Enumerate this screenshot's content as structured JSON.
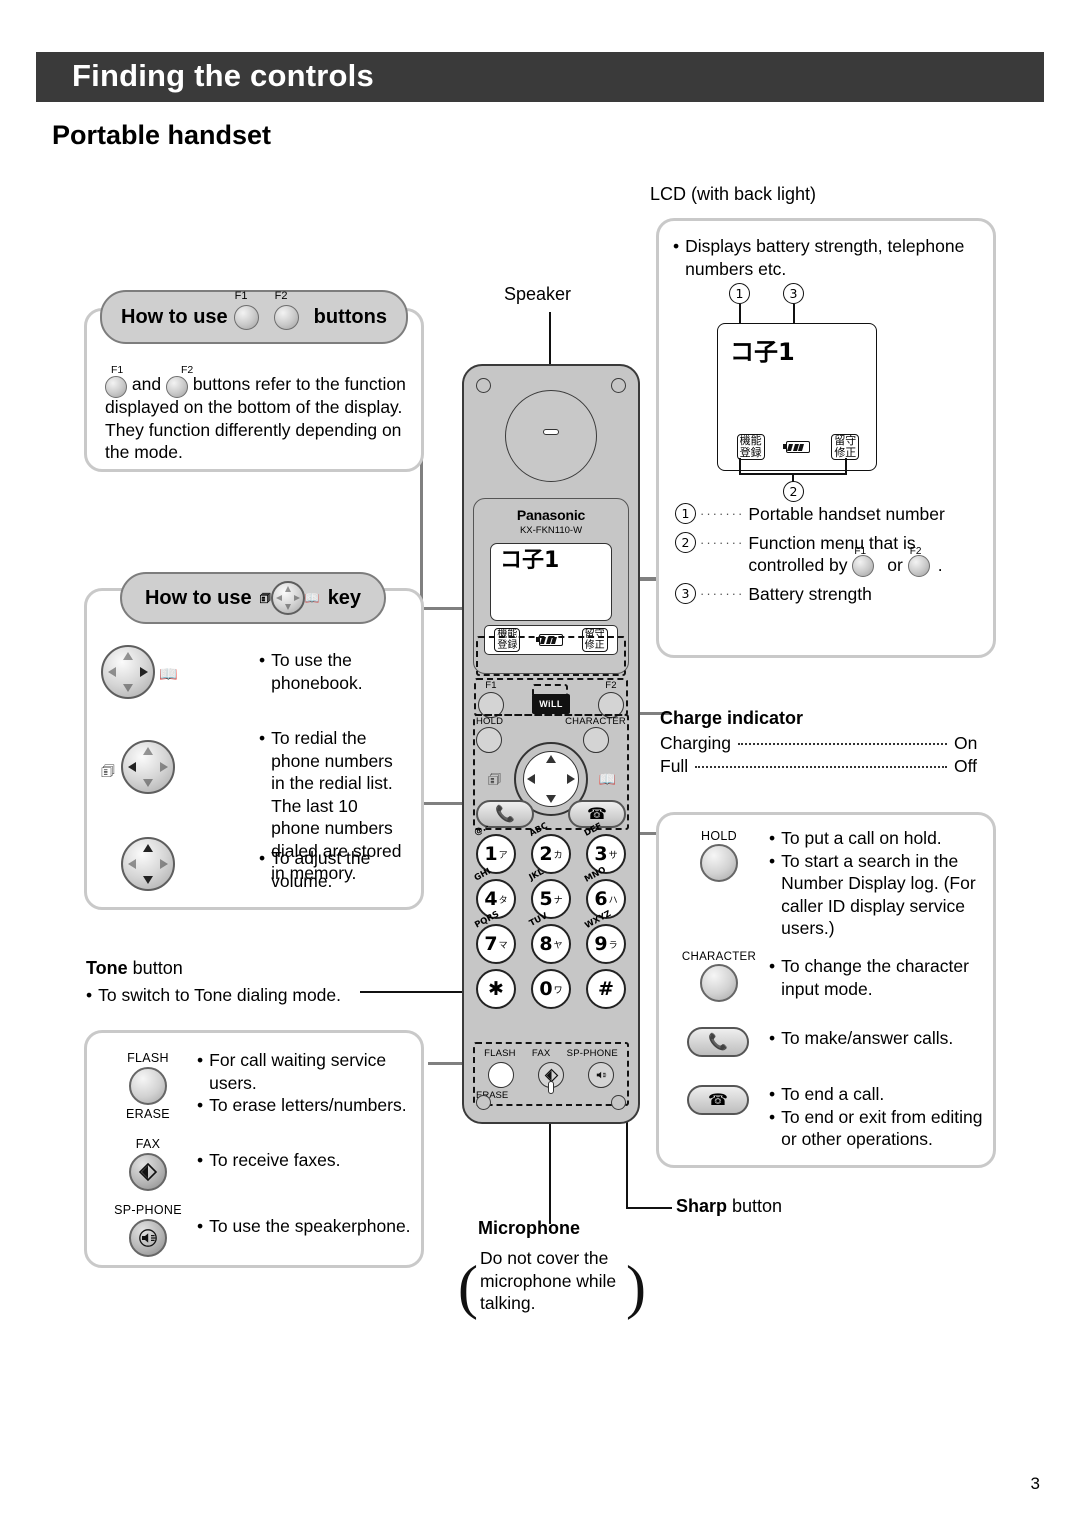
{
  "header": {
    "banner_title": "Finding the controls",
    "section_title": "Portable handset",
    "banner_bg": "#3a3a3a"
  },
  "page_number": "3",
  "labels": {
    "speaker": "Speaker",
    "lcd_caption": "LCD (with back light)",
    "microphone_title": "Microphone",
    "sharp_button": "Sharp button",
    "sharp_bold": "Sharp",
    "tone_title": "Tone button",
    "tone_bold": "Tone",
    "charge_title": "Charge indicator"
  },
  "callout_f": {
    "pill_prefix": "How to use",
    "pill_suffix": "buttons",
    "f1": "F1",
    "f2": "F2",
    "body_1": "and",
    "body_2": "buttons refer to the function displayed on the bottom of the display. They function differently depending on the mode."
  },
  "callout_nav": {
    "pill_prefix": "How to use",
    "pill_suffix": "key",
    "items": [
      {
        "text": "To use the phonebook."
      },
      {
        "text": "To redial the phone numbers in the redial list. The last 10 phone numbers dialed are stored in memory."
      },
      {
        "text": "To adjust the volume."
      }
    ]
  },
  "tone": {
    "bullet": "To switch to Tone dialing mode."
  },
  "left_buttons": [
    {
      "top_label": "FLASH",
      "bottom_label": "ERASE",
      "bullets": [
        "For call waiting service users.",
        "To erase letters/numbers."
      ]
    },
    {
      "top_label": "FAX",
      "bottom_label": "",
      "bullets": [
        "To receive faxes."
      ]
    },
    {
      "top_label": "SP-PHONE",
      "bottom_label": "",
      "bullets": [
        "To use the speakerphone."
      ]
    }
  ],
  "lcd_box": {
    "bullet": "Displays battery strength, telephone numbers etc.",
    "screen_number": "コ子1",
    "soft_left": "機能\n登録",
    "soft_left_line1": "機能",
    "soft_left_line2": "登録",
    "soft_right_line1": "留守",
    "soft_right_line2": "修正",
    "marker_1": "1",
    "marker_2": "2",
    "marker_3": "3",
    "legend": [
      {
        "num": "1",
        "text": "Portable handset number"
      },
      {
        "num": "2",
        "text": "Function menu that is controlled by"
      },
      {
        "num": "3",
        "text": "Battery strength"
      }
    ],
    "legend2_tail": ".",
    "legend2_or": "or",
    "f1": "F1",
    "f2": "F2"
  },
  "charge": {
    "rows": [
      {
        "label": "Charging",
        "value": "On"
      },
      {
        "label": "Full",
        "value": "Off"
      }
    ]
  },
  "right_buttons": [
    {
      "key_label": "HOLD",
      "icon": "round-button",
      "bullets": [
        "To put a call on hold.",
        "To start a search in the Number Display log. (For caller ID display service users.)"
      ]
    },
    {
      "key_label": "CHARACTER",
      "icon": "round-button",
      "bullets": [
        "To change the character input mode."
      ]
    },
    {
      "key_label": "",
      "icon": "talk-handset-icon",
      "bullets": [
        "To make/answer calls."
      ]
    },
    {
      "key_label": "",
      "icon": "off-handset-icon",
      "bullets": [
        "To end a call.",
        "To end or exit from editing or other operations."
      ]
    }
  ],
  "microphone": {
    "text": "Do not cover the microphone while talking."
  },
  "handset": {
    "brand": "Panasonic",
    "model": "KX-FKN110-W",
    "lcd_number": "コ子1",
    "soft_left_1": "機能",
    "soft_left_2": "登録",
    "soft_right_1": "留守",
    "soft_right_2": "修正",
    "f1": "F1",
    "f2": "F2",
    "will_logo": "WiLL",
    "hold": "HOLD",
    "character": "CHARACTER",
    "keypad": [
      {
        "digit": "1",
        "abc": "@.-",
        "kana": "ア"
      },
      {
        "digit": "2",
        "abc": "ABC",
        "kana": "カ"
      },
      {
        "digit": "3",
        "abc": "DEF",
        "kana": "サ"
      },
      {
        "digit": "4",
        "abc": "GHI",
        "kana": "タ"
      },
      {
        "digit": "5",
        "abc": "JKL",
        "kana": "ナ"
      },
      {
        "digit": "6",
        "abc": "MNO",
        "kana": "ハ"
      },
      {
        "digit": "7",
        "abc": "PQRS",
        "kana": "マ"
      },
      {
        "digit": "8",
        "abc": "TUV",
        "kana": "ヤ"
      },
      {
        "digit": "9",
        "abc": "WXYZ",
        "kana": "ラ"
      },
      {
        "digit": "✱",
        "abc": "",
        "kana": ""
      },
      {
        "digit": "0",
        "abc": "",
        "kana": "ワ"
      },
      {
        "digit": "#",
        "abc": "",
        "kana": ""
      }
    ],
    "bottom_labels": {
      "flash": "FLASH",
      "fax": "FAX",
      "sp_phone": "SP-PHONE",
      "erase": "ERASE"
    }
  }
}
